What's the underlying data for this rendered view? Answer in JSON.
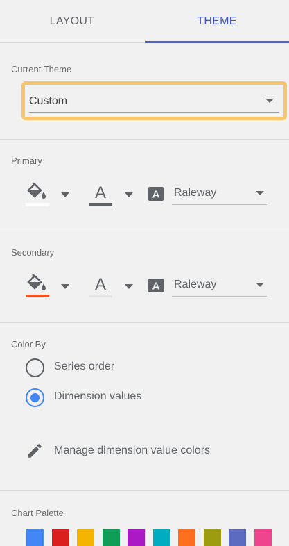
{
  "tabs": {
    "layout": "LAYOUT",
    "theme": "THEME"
  },
  "current_theme": {
    "label": "Current Theme",
    "value": "Custom"
  },
  "primary": {
    "label": "Primary",
    "font": "Raleway",
    "fill_underline_color": "#ffffff",
    "text_underline_color": "#5f6368"
  },
  "secondary": {
    "label": "Secondary",
    "font": "Raleway",
    "fill_underline_color": "#f4511e",
    "text_underline_color": "#e6e6e6"
  },
  "color_by": {
    "label": "Color By",
    "options": [
      "Series order",
      "Dimension values"
    ],
    "selected": "Dimension values",
    "manage_label": "Manage dimension value colors"
  },
  "chart_palette": {
    "label": "Chart Palette",
    "colors": [
      "#4285f4",
      "#db1f1f",
      "#f4b400",
      "#0f9d58",
      "#ab18c6",
      "#00acc1",
      "#ff6d1f",
      "#9e9d12",
      "#5c6bc0",
      "#f0448f"
    ]
  }
}
